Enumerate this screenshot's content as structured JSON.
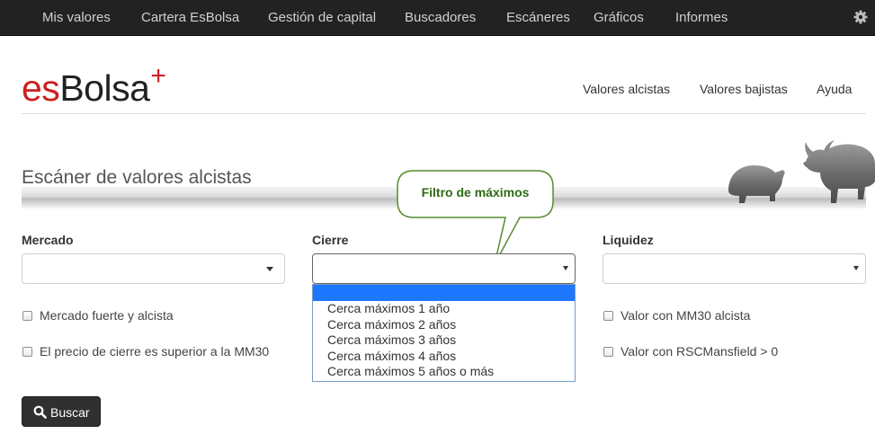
{
  "topnav": {
    "items": [
      "Mis valores",
      "Cartera EsBolsa",
      "Gestión de capital",
      "Buscadores",
      "Escáneres",
      "Gráficos",
      "Informes"
    ],
    "settings_icon": "gear-icon"
  },
  "logo": {
    "prefix": "es",
    "name": "Bolsa",
    "plus": "+"
  },
  "header_nav": {
    "items": [
      "Valores alcistas",
      "Valores bajistas",
      "Ayuda"
    ]
  },
  "page": {
    "title": "Escáner de valores alcistas",
    "banner_image": "bear-and-bull-statues"
  },
  "callout": {
    "text": "Filtro de máximos"
  },
  "form": {
    "mercado": {
      "label": "Mercado",
      "value": ""
    },
    "cierre": {
      "label": "Cierre",
      "value": "",
      "options": [
        "",
        "Cerca máximos 1 año",
        "Cerca máximos 2 años",
        "Cerca máximos 3 años",
        "Cerca máximos 4 años",
        "Cerca máximos 5 años o más"
      ]
    },
    "liquidez": {
      "label": "Liquidez",
      "value": ""
    },
    "checkboxes": {
      "c1": "Mercado fuerte y alcista",
      "c2": "El precio de cierre es superior a la MM30",
      "c3": "Valor con MM30 alcista",
      "c4": "Valor con RSCMansfield > 0"
    },
    "search_button": "Buscar"
  },
  "colors": {
    "navbar": "#222222",
    "brand_red": "#cc1f1f",
    "callout_green": "#2e6b14",
    "highlight": "#1e78ff"
  }
}
